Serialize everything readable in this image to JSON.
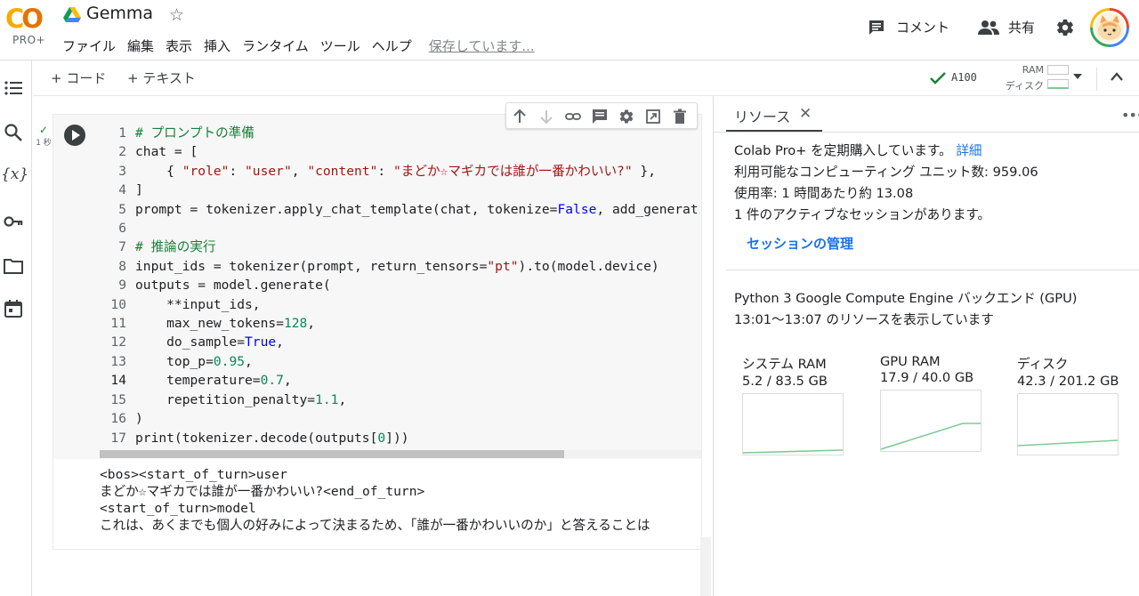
{
  "app": {
    "logo_text": "CO",
    "logo_sub": "PRO+",
    "title": "Gemma",
    "menu": [
      "ファイル",
      "編集",
      "表示",
      "挿入",
      "ランタイム",
      "ツール",
      "ヘルプ"
    ],
    "saving_status": "保存しています...",
    "comment_label": "コメント",
    "share_label": "共有"
  },
  "toolbar": {
    "add_code": "+ コード",
    "add_text": "+ テキスト",
    "runtime": "A100",
    "ram_label": "RAM",
    "disk_label": "ディスク"
  },
  "cell": {
    "exec_time": "1 秒",
    "code_lines": [
      {
        "n": "1"
      },
      {
        "n": "2"
      },
      {
        "n": "3"
      },
      {
        "n": "4"
      },
      {
        "n": "5"
      },
      {
        "n": "6"
      },
      {
        "n": "7"
      },
      {
        "n": "8"
      },
      {
        "n": "9"
      },
      {
        "n": "10"
      },
      {
        "n": "11"
      },
      {
        "n": "12"
      },
      {
        "n": "13"
      },
      {
        "n": "14"
      },
      {
        "n": "15"
      },
      {
        "n": "16"
      },
      {
        "n": "17"
      }
    ],
    "code": {
      "l1": "# プロンプトの準備",
      "l2a": "chat = [",
      "l3a": "    { ",
      "l3b": "\"role\"",
      "l3c": ": ",
      "l3d": "\"user\"",
      "l3e": ", ",
      "l3f": "\"content\"",
      "l3g": ": ",
      "l3h": "\"まどか☆マギカでは誰が一番かわいい?\"",
      "l3i": " },",
      "l4": "]",
      "l5a": "prompt = tokenizer.apply_chat_template(chat, tokenize=",
      "l5b": "False",
      "l5c": ", add_generation_prompt=",
      "l6": "",
      "l7": "# 推論の実行",
      "l8a": "input_ids = tokenizer(prompt, return_tensors=",
      "l8b": "\"pt\"",
      "l8c": ").to(model.device)",
      "l9": "outputs = model.generate(",
      "l10": "    **input_ids,",
      "l11a": "    max_new_tokens=",
      "l11b": "128",
      "l11c": ",",
      "l12a": "    do_sample=",
      "l12b": "True",
      "l12c": ",",
      "l13a": "    top_p=",
      "l13b": "0.95",
      "l13c": ",",
      "l14a": "    temperature=",
      "l14b": "0.7",
      "l14c": ",",
      "l15a": "    repetition_penalty=",
      "l15b": "1.1",
      "l15c": ",",
      "l16": ")",
      "l17a": "print(tokenizer.decode(outputs[",
      "l17b": "0",
      "l17c": "]))"
    },
    "output": [
      "<bos><start_of_turn>user",
      "まどか☆マギカでは誰が一番かわいい?<end_of_turn>",
      "<start_of_turn>model",
      "これは、あくまでも個人の好みによって決まるため、「誰が一番かわいいのか」と答えることは"
    ]
  },
  "resources": {
    "tab_title": "リソース",
    "sub_line": "Colab Pro+ を定期購入しています。",
    "detail_link": "詳細",
    "units_line": "利用可能なコンピューティング ユニット数: 959.06",
    "usage_line": "使用率: 1 時間あたり約 13.08",
    "active_line": "1 件のアクティブなセッションがあります。",
    "manage_link": "セッションの管理",
    "backend_line": "Python 3 Google Compute Engine バックエンド (GPU)",
    "range_line": "13:01〜13:07 のリソースを表示しています",
    "gauges": [
      {
        "name": "システム RAM",
        "value": "5.2 / 83.5 GB",
        "used": 5.2,
        "total": 83.5
      },
      {
        "name": "GPU RAM",
        "value": "17.9 / 40.0 GB",
        "used": 17.9,
        "total": 40.0
      },
      {
        "name": "ディスク",
        "value": "42.3 / 201.2 GB",
        "used": 42.3,
        "total": 201.2
      }
    ]
  },
  "colors": {
    "accent": "#1a73e8",
    "gauge_line": "#81c995",
    "check": "#188038"
  }
}
